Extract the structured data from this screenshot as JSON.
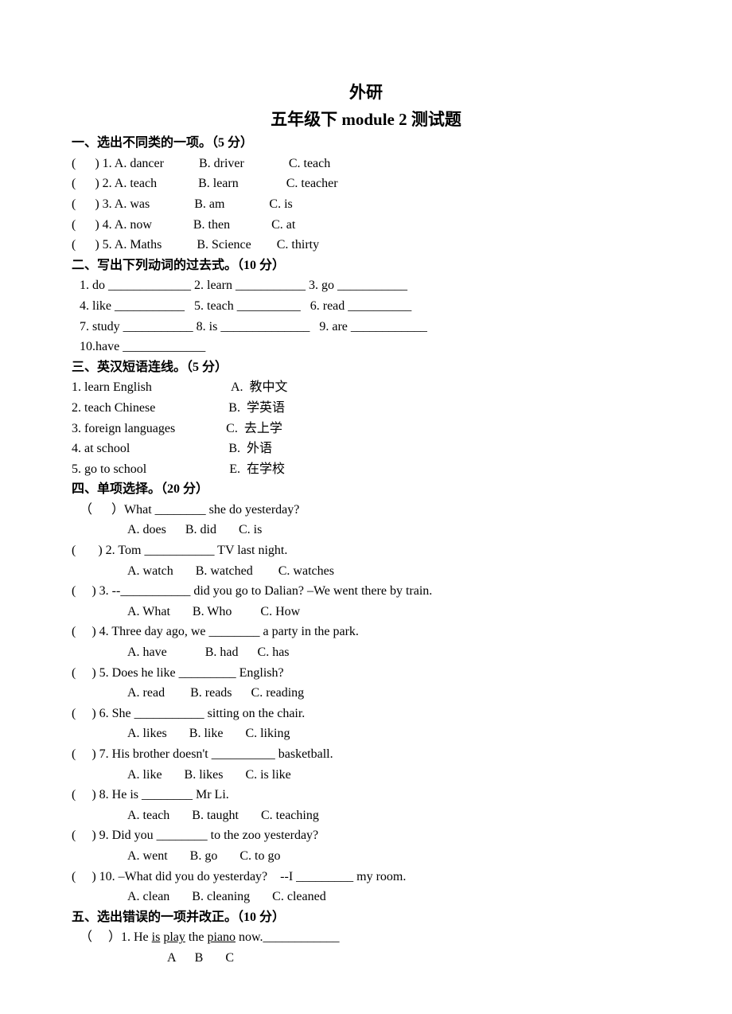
{
  "title1": "外研",
  "title2": "五年级下 module 2    测试题",
  "sec1": {
    "heading": "一、选出不同类的一项。（5 分）",
    "q1": "(      ) 1. A. dancer           B. driver              C. teach",
    "q2": "(      ) 2. A. teach             B. learn               C. teacher",
    "q3": "(      ) 3. A. was              B. am              C. is",
    "q4": "(      ) 4. A. now             B. then             C. at",
    "q5": "(      ) 5. A. Maths           B. Science        C. thirty"
  },
  "sec2": {
    "heading": "二、写出下列动词的过去式。（10 分）",
    "l1": "1. do _____________ 2. learn ___________ 3. go ___________",
    "l2": "4. like ___________   5. teach __________   6. read __________",
    "l3": "7. study ___________ 8. is ______________   9. are ____________",
    "l4": "10.have _____________"
  },
  "sec3": {
    "heading": "三、英汉短语连线。（5 分）",
    "l1": "1. learn English                         A.  教中文",
    "l2": "2. teach Chinese                       B.  学英语",
    "l3": "3. foreign languages                C.  去上学",
    "l4": "4. at school                               B.  外语",
    "l5": "5. go to school                          E.  在学校"
  },
  "sec4": {
    "heading": "四、单项选择。（20 分）",
    "q1": "（      ）What ________ she do yesterday?",
    "c1": "A. does      B. did       C. is",
    "q2": "(       ) 2. Tom ___________ TV last night.",
    "c2": "A. watch       B. watched        C. watches",
    "q3": "(     ) 3. --___________ did you go to Dalian? –We went there by train.",
    "c3": "A. What       B. Who         C. How",
    "q4": "(     ) 4. Three day ago, we ________ a party in the park.",
    "c4": "A. have            B. had      C. has",
    "q5": "(     ) 5. Does he like _________ English?",
    "c5": "A. read        B. reads      C. reading",
    "q6": "(     ) 6. She ___________ sitting on the chair.",
    "c6": "A. likes       B. like       C. liking",
    "q7": "(     ) 7. His brother doesn't __________ basketball.",
    "c7": "A. like       B. likes       C. is like",
    "q8": "(     ) 8. He is ________ Mr Li.",
    "c8": "A. teach       B. taught       C. teaching",
    "q9": "(     ) 9. Did you ________ to the zoo yesterday?",
    "c9": "A. went       B. go       C. to go",
    "q10": "(     ) 10. –What did you do yesterday?    --I _________ my room.",
    "c10": "A. clean       B. cleaning       C. cleaned"
  },
  "sec5": {
    "heading": "五、选出错误的一项并改正。（10 分）",
    "q1_pre": "（     ）1. He ",
    "q1_u1": "is",
    "q1_mid1": " ",
    "q1_u2": "play",
    "q1_mid2": " the ",
    "q1_u3": "piano",
    "q1_post": " now.____________",
    "labels": "A      B       C"
  }
}
